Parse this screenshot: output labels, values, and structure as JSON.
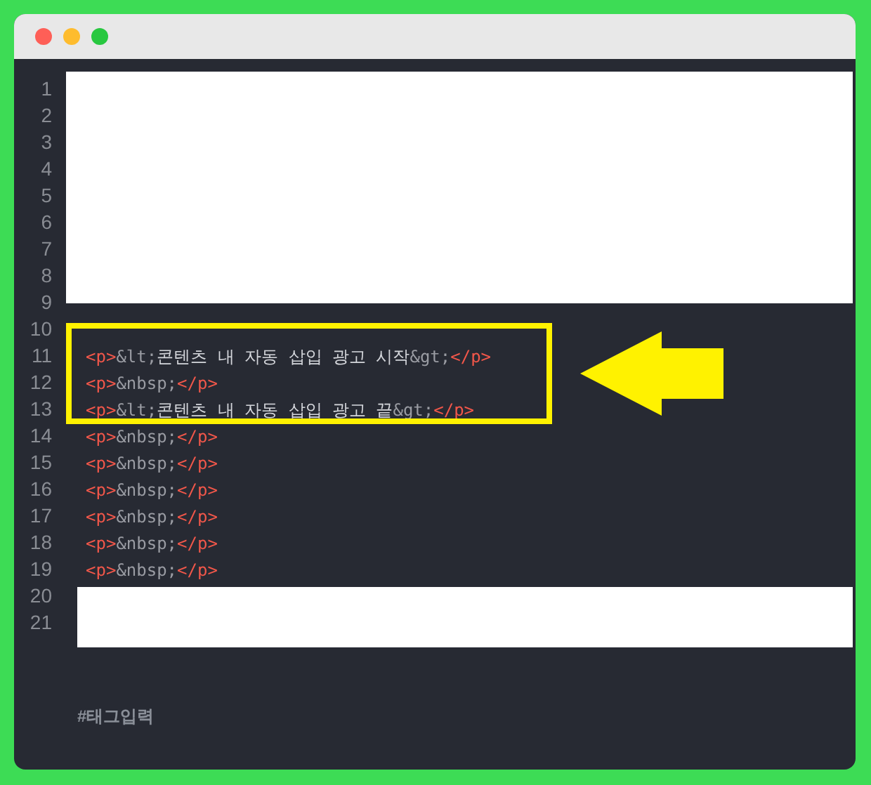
{
  "window": {
    "controls": [
      {
        "color": "#fe5f57"
      },
      {
        "color": "#febc2e"
      },
      {
        "color": "#28c840"
      }
    ]
  },
  "editor": {
    "lines": [
      {
        "number": "1"
      },
      {
        "number": "2"
      },
      {
        "number": "3"
      },
      {
        "number": "4"
      },
      {
        "number": "5"
      },
      {
        "number": "6"
      },
      {
        "number": "7"
      },
      {
        "number": "8"
      },
      {
        "number": "9"
      },
      {
        "number": "10"
      },
      {
        "number": "11",
        "tokens": [
          {
            "kind": "tag",
            "text": "<p>"
          },
          {
            "kind": "entity",
            "text": "&lt;"
          },
          {
            "kind": "text",
            "text": "콘텐츠 내 자동 삽입 광고 시작"
          },
          {
            "kind": "entity",
            "text": "&gt;"
          },
          {
            "kind": "tag",
            "text": "</p>"
          }
        ]
      },
      {
        "number": "12",
        "tokens": [
          {
            "kind": "tag",
            "text": "<p>"
          },
          {
            "kind": "entity",
            "text": "&nbsp;"
          },
          {
            "kind": "tag",
            "text": "</p>"
          }
        ]
      },
      {
        "number": "13",
        "tokens": [
          {
            "kind": "tag",
            "text": "<p>"
          },
          {
            "kind": "entity",
            "text": "&lt;"
          },
          {
            "kind": "text",
            "text": "콘텐츠 내 자동 삽입 광고 끝"
          },
          {
            "kind": "entity",
            "text": "&gt;"
          },
          {
            "kind": "tag",
            "text": "</p>"
          }
        ]
      },
      {
        "number": "14",
        "tokens": [
          {
            "kind": "tag",
            "text": "<p>"
          },
          {
            "kind": "entity",
            "text": "&nbsp;"
          },
          {
            "kind": "tag",
            "text": "</p>"
          }
        ]
      },
      {
        "number": "15",
        "tokens": [
          {
            "kind": "tag",
            "text": "<p>"
          },
          {
            "kind": "entity",
            "text": "&nbsp;"
          },
          {
            "kind": "tag",
            "text": "</p>"
          }
        ]
      },
      {
        "number": "16",
        "tokens": [
          {
            "kind": "tag",
            "text": "<p>"
          },
          {
            "kind": "entity",
            "text": "&nbsp;"
          },
          {
            "kind": "tag",
            "text": "</p>"
          }
        ]
      },
      {
        "number": "17",
        "tokens": [
          {
            "kind": "tag",
            "text": "<p>"
          },
          {
            "kind": "entity",
            "text": "&nbsp;"
          },
          {
            "kind": "tag",
            "text": "</p>"
          }
        ]
      },
      {
        "number": "18",
        "tokens": [
          {
            "kind": "tag",
            "text": "<p>"
          },
          {
            "kind": "entity",
            "text": "&nbsp;"
          },
          {
            "kind": "tag",
            "text": "</p>"
          }
        ]
      },
      {
        "number": "19",
        "tokens": [
          {
            "kind": "tag",
            "text": "<p>"
          },
          {
            "kind": "entity",
            "text": "&nbsp;"
          },
          {
            "kind": "tag",
            "text": "</p>"
          }
        ]
      },
      {
        "number": "20"
      },
      {
        "number": "21"
      }
    ]
  },
  "annotations": [
    {
      "kind": "cover"
    },
    {
      "kind": "cover"
    },
    {
      "kind": "highlight"
    },
    {
      "kind": "arrow"
    }
  ],
  "tag_input": {
    "placeholder": "#태그입력"
  }
}
